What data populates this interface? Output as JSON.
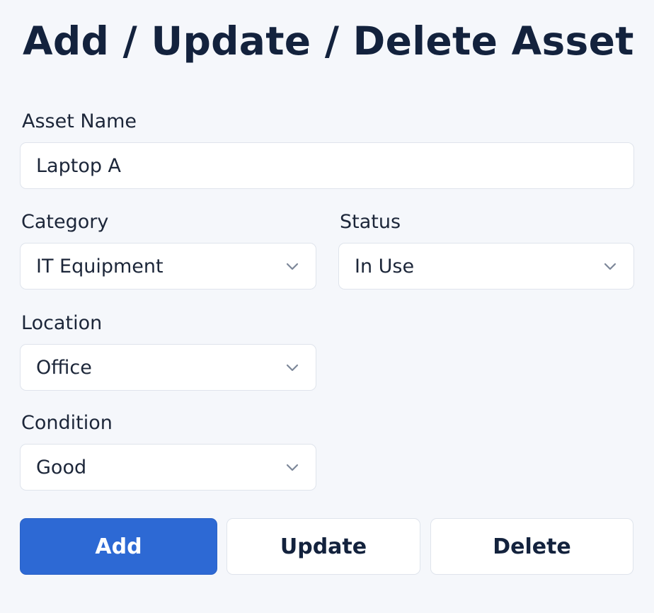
{
  "page": {
    "title": "Add / Update / Delete Asset"
  },
  "form": {
    "asset_name": {
      "label": "Asset Name",
      "value": "Laptop A"
    },
    "category": {
      "label": "Category",
      "value": "IT Equipment"
    },
    "status": {
      "label": "Status",
      "value": "In Use"
    },
    "location": {
      "label": "Location",
      "value": "Office"
    },
    "condition": {
      "label": "Condition",
      "value": "Good"
    }
  },
  "actions": {
    "add_label": "Add",
    "update_label": "Update",
    "delete_label": "Delete"
  },
  "icons": {
    "dropdown": "chevron-down-icon"
  },
  "colors": {
    "primary": "#2d69d4",
    "background": "#f5f7fb",
    "title": "#13223d",
    "chevron": "#7d8799"
  }
}
